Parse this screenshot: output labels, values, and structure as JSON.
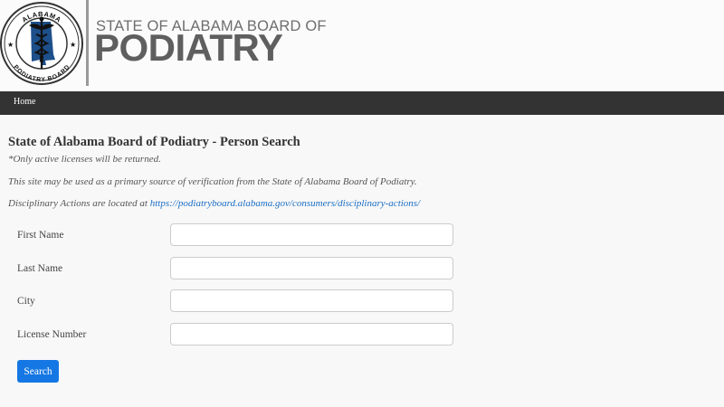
{
  "header": {
    "seal_top_text": "ALABAMA",
    "seal_bottom_text": "PODIATRY BOARD",
    "logo_line1": "STATE OF ALABAMA BOARD OF",
    "logo_line2": "PODIATRY"
  },
  "nav": {
    "home_label": "Home"
  },
  "main": {
    "title": "State of Alabama Board of Podiatry - Person Search",
    "note_active": "*Only active licenses will be returned.",
    "note_primary": "This site may be used as a primary source of verification from the State of Alabama Board of Podiatry.",
    "note_disciplinary_prefix": "Disciplinary Actions are located at ",
    "disciplinary_link": "https://podiatryboard.alabama.gov/consumers/disciplinary-actions/"
  },
  "form": {
    "first_name_label": "First Name",
    "first_name_value": "",
    "last_name_label": "Last Name",
    "last_name_value": "",
    "city_label": "City",
    "city_value": "",
    "license_label": "License Number",
    "license_value": "",
    "search_label": "Search"
  },
  "colors": {
    "navbar": "#333333",
    "button": "#1577e3",
    "link": "#1a6ec4"
  }
}
